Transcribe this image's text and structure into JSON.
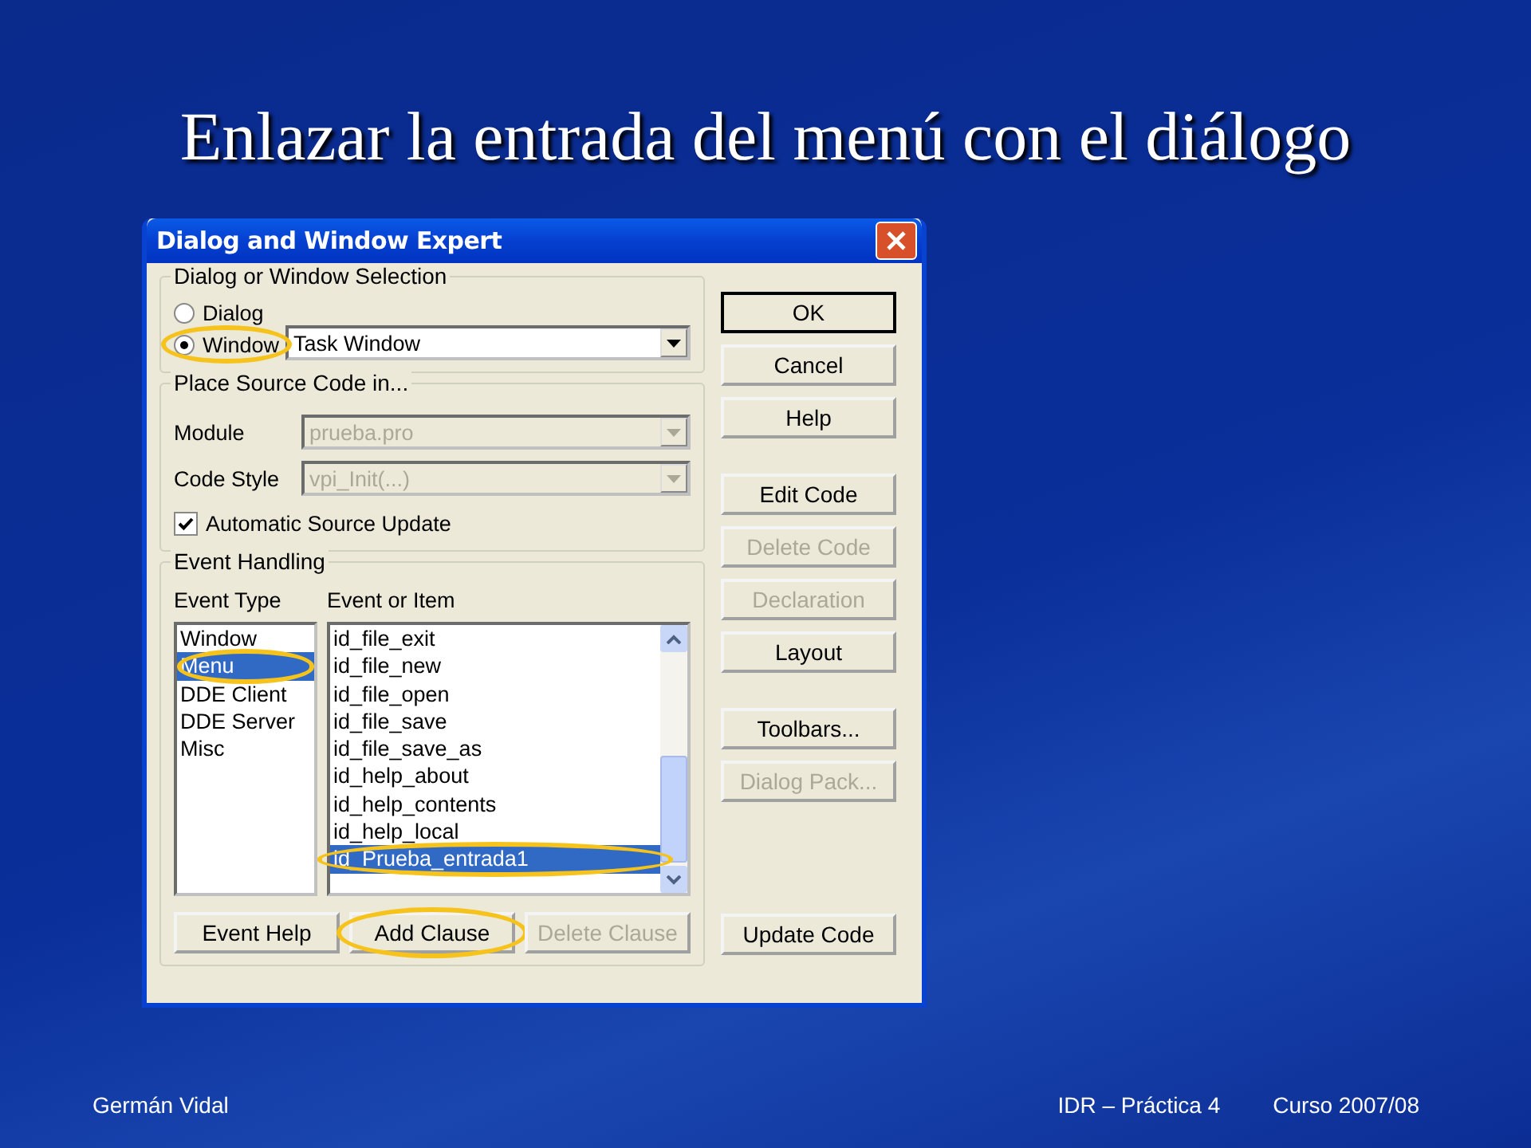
{
  "slide_title": "Enlazar la entrada del menú con el diálogo",
  "dialog": {
    "title": "Dialog and Window Expert",
    "selection_group": {
      "label": "Dialog or Window Selection",
      "radios": [
        {
          "label": "Dialog",
          "checked": false,
          "circled": false
        },
        {
          "label": "Window",
          "checked": true,
          "circled": true
        }
      ],
      "combo": {
        "value": "Task Window",
        "disabled": false
      }
    },
    "source_group": {
      "label": "Place Source Code in...",
      "fields": [
        {
          "label": "Module",
          "value": "prueba.pro",
          "disabled": true
        },
        {
          "label": "Code Style",
          "value": "vpi_Init(...)",
          "disabled": true
        }
      ],
      "checkbox": {
        "label": "Automatic Source Update",
        "checked": true
      }
    },
    "event_group": {
      "label": "Event Handling",
      "type_label": "Event Type",
      "item_label": "Event or Item",
      "event_types": [
        {
          "label": "Window",
          "selected": false,
          "circled": false
        },
        {
          "label": "Menu",
          "selected": true,
          "circled": true
        },
        {
          "label": "DDE Client",
          "selected": false,
          "circled": false
        },
        {
          "label": "DDE Server",
          "selected": false,
          "circled": false
        },
        {
          "label": "Misc",
          "selected": false,
          "circled": false
        }
      ],
      "events": [
        {
          "label": "id_file_exit",
          "selected": false,
          "circled": false
        },
        {
          "label": "id_file_new",
          "selected": false,
          "circled": false
        },
        {
          "label": "id_file_open",
          "selected": false,
          "circled": false
        },
        {
          "label": "id_file_save",
          "selected": false,
          "circled": false
        },
        {
          "label": "id_file_save_as",
          "selected": false,
          "circled": false
        },
        {
          "label": "id_help_about",
          "selected": false,
          "circled": false
        },
        {
          "label": "id_help_contents",
          "selected": false,
          "circled": false
        },
        {
          "label": "id_help_local",
          "selected": false,
          "circled": false
        },
        {
          "label": "id_Prueba_entrada1",
          "selected": true,
          "circled": true
        }
      ],
      "buttons": [
        {
          "label": "Event Help",
          "disabled": false,
          "circled": false
        },
        {
          "label": "Add Clause",
          "disabled": false,
          "circled": true
        },
        {
          "label": "Delete Clause",
          "disabled": true,
          "circled": false
        }
      ]
    },
    "button_groups": [
      [
        {
          "label": "OK",
          "disabled": false,
          "default": true
        },
        {
          "label": "Cancel",
          "disabled": false,
          "default": false
        },
        {
          "label": "Help",
          "disabled": false,
          "default": false
        }
      ],
      [
        {
          "label": "Edit Code",
          "disabled": false,
          "default": false
        },
        {
          "label": "Delete Code",
          "disabled": true,
          "default": false
        },
        {
          "label": "Declaration",
          "disabled": true,
          "default": false
        },
        {
          "label": "Layout",
          "disabled": false,
          "default": false
        }
      ],
      [
        {
          "label": "Toolbars...",
          "disabled": false,
          "default": false
        },
        {
          "label": "Dialog Pack...",
          "disabled": true,
          "default": false
        }
      ],
      [
        {
          "label": "Update Code",
          "disabled": false,
          "default": false
        }
      ]
    ]
  },
  "footer": {
    "author": "Germán Vidal",
    "course": "IDR – Práctica 4",
    "year": "Curso 2007/08"
  }
}
